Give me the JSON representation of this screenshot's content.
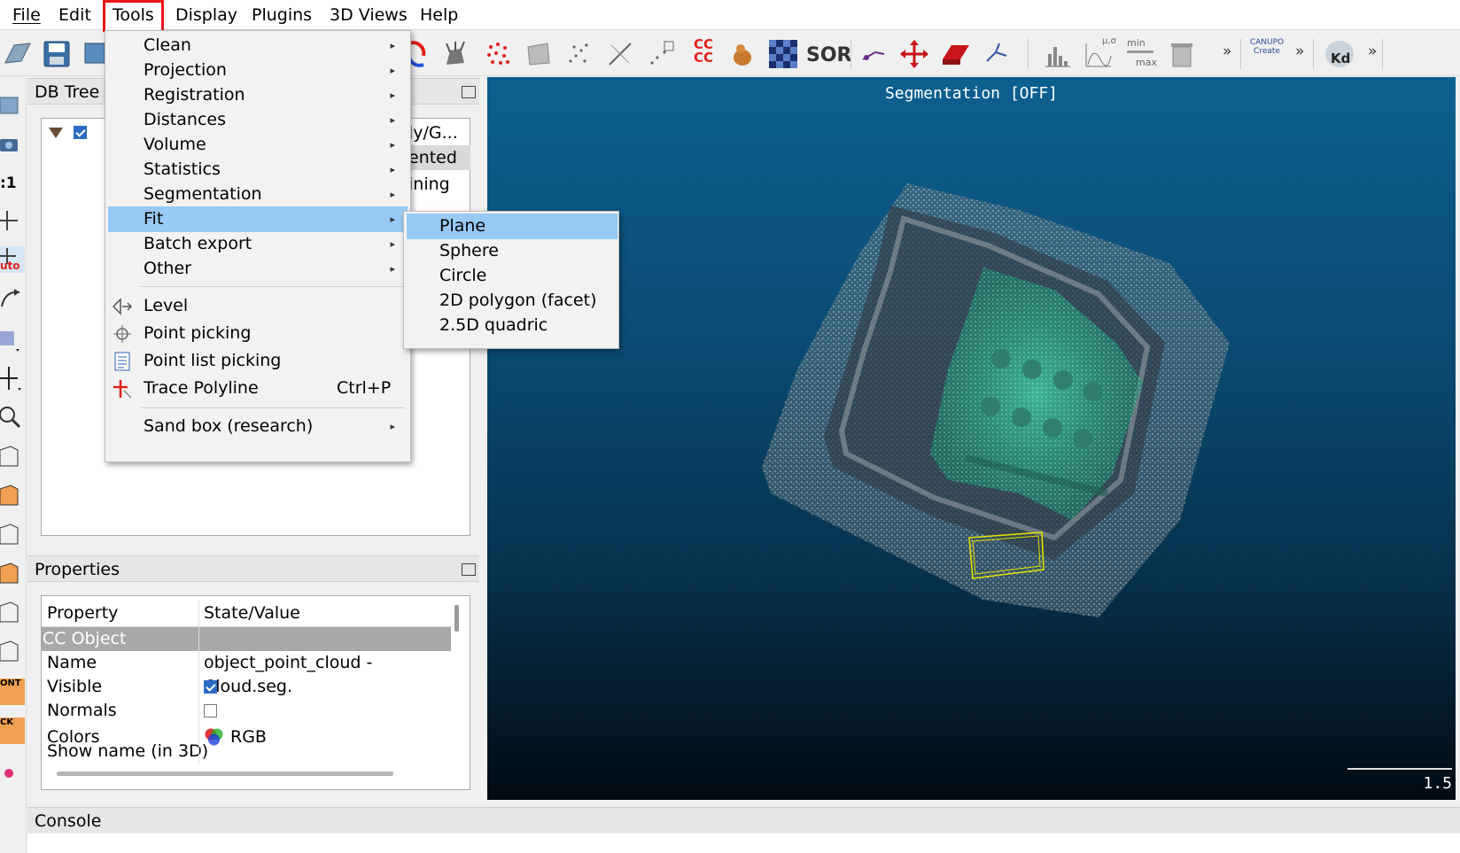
{
  "menubar": {
    "items": [
      "File",
      "Edit",
      "Tools",
      "Display",
      "Plugins",
      "3D Views",
      "Help"
    ],
    "active": "Tools"
  },
  "toolbar": {
    "cc_label": "CC CC",
    "sor_label": "SOR",
    "stat_label": "μ,σ",
    "minmax_min": "min",
    "minmax_max": "max",
    "canupo_label": "CANUPO Create",
    "kd_label": "Kd",
    "more": "»"
  },
  "left_toolbar": {
    "ratio_label": ":1",
    "auto_label": "uto",
    "font_label": "ONT",
    "back_label": "CK"
  },
  "db_tree": {
    "title": "DB Tree",
    "partial_texts": [
      "ly/G...",
      "ented",
      "ining"
    ]
  },
  "properties": {
    "title": "Properties",
    "header_property": "Property",
    "header_value": "State/Value",
    "section": "CC Object",
    "rows": [
      {
        "name": "Name",
        "value": "object_point_cloud - Cloud.seg."
      },
      {
        "name": "Visible",
        "checked": true
      },
      {
        "name": "Normals",
        "checked": false
      },
      {
        "name": "Colors",
        "value": "RGB"
      },
      {
        "name": "Show name (in 3D)"
      }
    ]
  },
  "console": {
    "title": "Console"
  },
  "view3d": {
    "segmentation_label": "Segmentation [OFF]",
    "scale_value": "1.5"
  },
  "tools_menu": {
    "submenu_items": [
      "Clean",
      "Projection",
      "Registration",
      "Distances",
      "Volume",
      "Statistics",
      "Segmentation",
      "Fit",
      "Batch export",
      "Other"
    ],
    "highlighted": "Fit",
    "action_items": [
      {
        "label": "Level",
        "icon": "level-icon"
      },
      {
        "label": "Point picking",
        "icon": "point-picking-icon"
      },
      {
        "label": "Point list picking",
        "icon": "point-list-icon"
      },
      {
        "label": "Trace Polyline",
        "icon": "trace-polyline-icon",
        "shortcut": "Ctrl+P"
      }
    ],
    "sandbox": "Sand box (research)"
  },
  "fit_menu": {
    "items": [
      "Plane",
      "Sphere",
      "Circle",
      "2D polygon (facet)",
      "2.5D quadric"
    ],
    "highlighted": "Plane"
  },
  "colors": {
    "menu_highlight": "#99c9f5",
    "active_menu_border": "#e8161b",
    "view_top": "#0c6090",
    "view_bottom": "#020b12",
    "cloud_green": "#3fc8a0",
    "selection_box": "#e5e000"
  }
}
